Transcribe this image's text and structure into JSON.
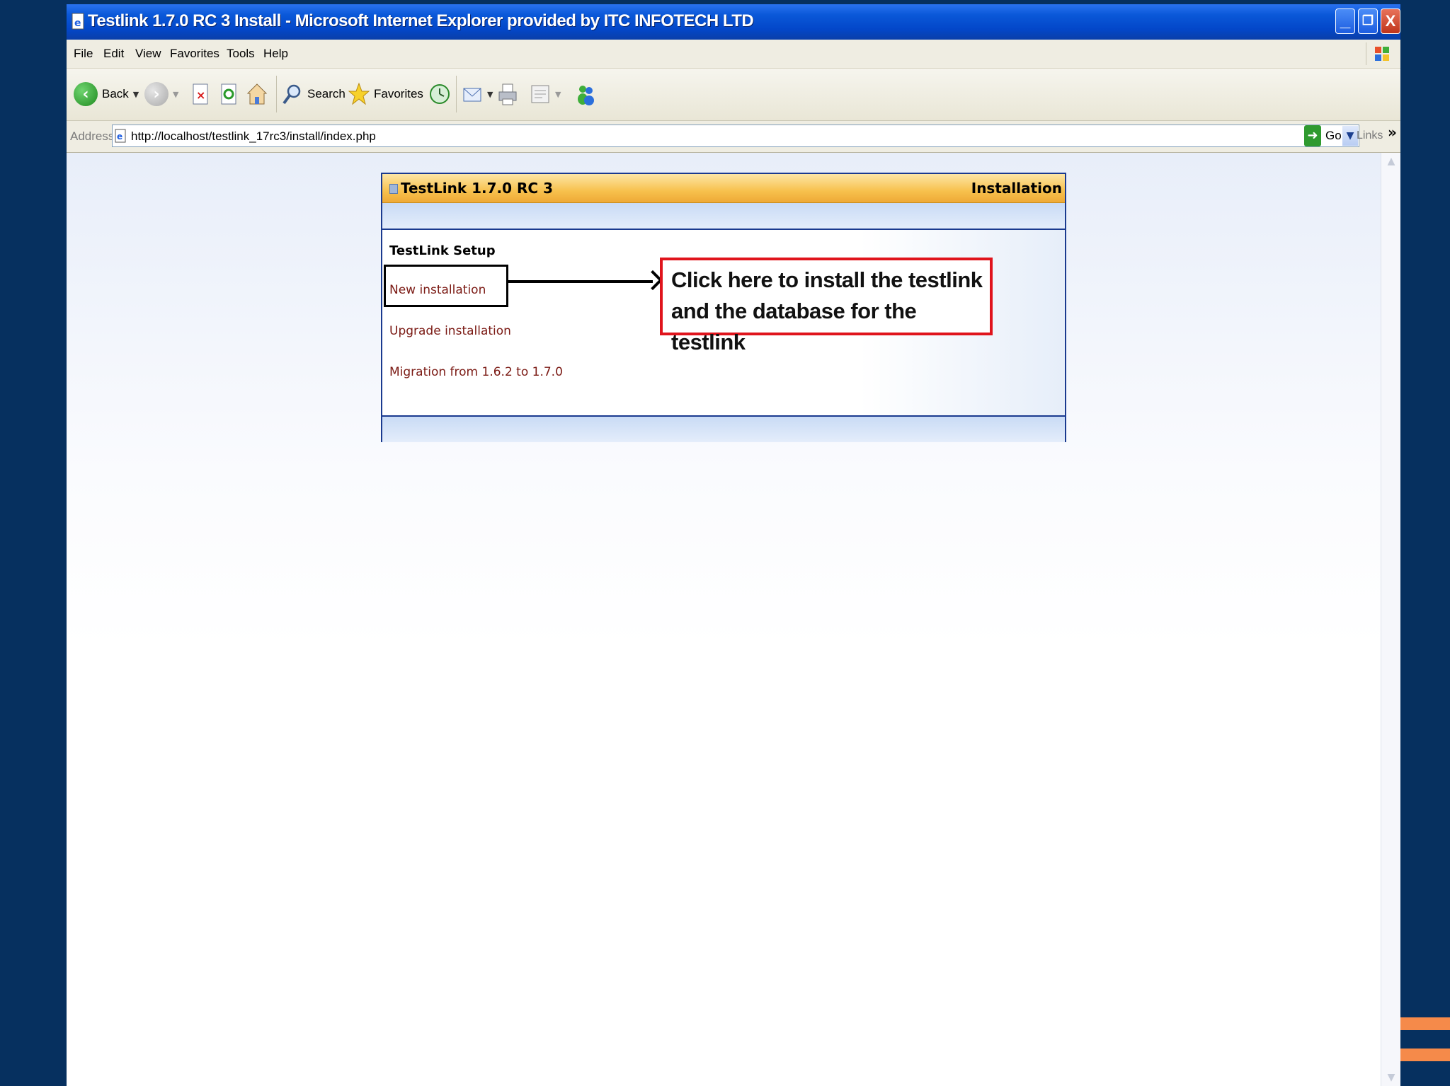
{
  "window": {
    "title": "Testlink 1.7.0 RC 3 Install - Microsoft Internet Explorer provided by ITC INFOTECH LTD",
    "controls": {
      "minimize": "_",
      "maximize": "❐",
      "close": "X"
    }
  },
  "menu": [
    "File",
    "Edit",
    "View",
    "Favorites",
    "Tools",
    "Help"
  ],
  "toolbar": {
    "back_label": "Back",
    "search_label": "Search",
    "favorites_label": "Favorites"
  },
  "address": {
    "label": "Address",
    "url": "http://localhost/testlink_17rc3/install/index.php",
    "go_label": "Go",
    "links_label": "Links",
    "links_chevron": "»"
  },
  "panel": {
    "app_title": "TestLink 1.7.0 RC 3",
    "section_title": "Installation",
    "setup_heading": "TestLink Setup",
    "links": [
      "New installation",
      "Upgrade installation",
      "Migration from 1.6.2 to 1.7.0"
    ]
  },
  "callout": {
    "line1": "Click here to install the testlink",
    "line2": "and the database for the testlink"
  },
  "colors": {
    "desktop": "#06305f",
    "titlebar": "#0a58d8",
    "panel_header": "#f7c14d",
    "link": "#7b1a14",
    "callout_border": "#e0141c",
    "accent_stripes": "#f58a4a"
  }
}
